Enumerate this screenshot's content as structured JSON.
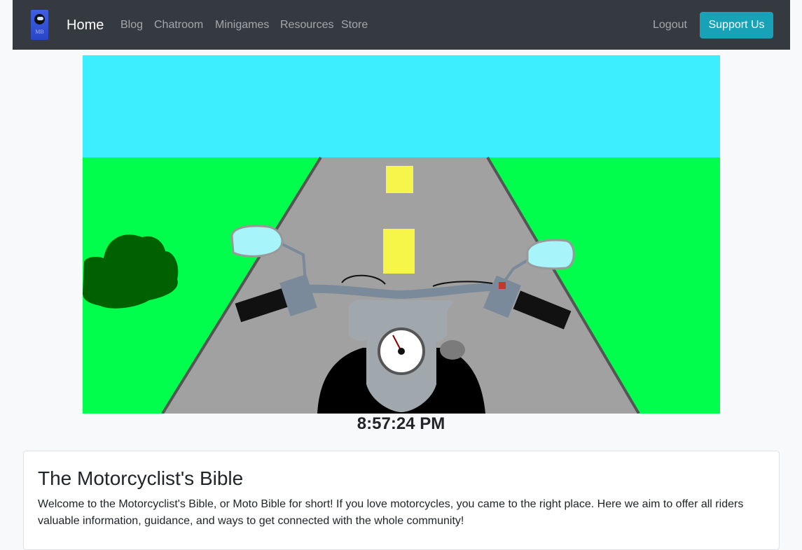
{
  "nav": {
    "brand_text": "MB",
    "home": "Home",
    "links": [
      "Blog",
      "Chatroom",
      "Minigames",
      "Resources",
      "Store"
    ],
    "logout": "Logout",
    "support": "Support Us",
    "brand_icon": "helmet-icon"
  },
  "game": {
    "clock": "8:57:24 PM",
    "colors": {
      "sky": "#3ceeff",
      "grass": "#00ff4c",
      "road": "#a1a1a1",
      "lane": "#f5f54a",
      "bush": "#006100",
      "mirror": "#a7f4fb"
    }
  },
  "card": {
    "title": "The Motorcyclist's Bible",
    "body": "Welcome to the Motorcyclist's Bible, or Moto Bible for short! If you love motorcycles, you came to the right place. Here we aim to offer all riders valuable information, guidance, and ways to get connected with the whole community!"
  }
}
